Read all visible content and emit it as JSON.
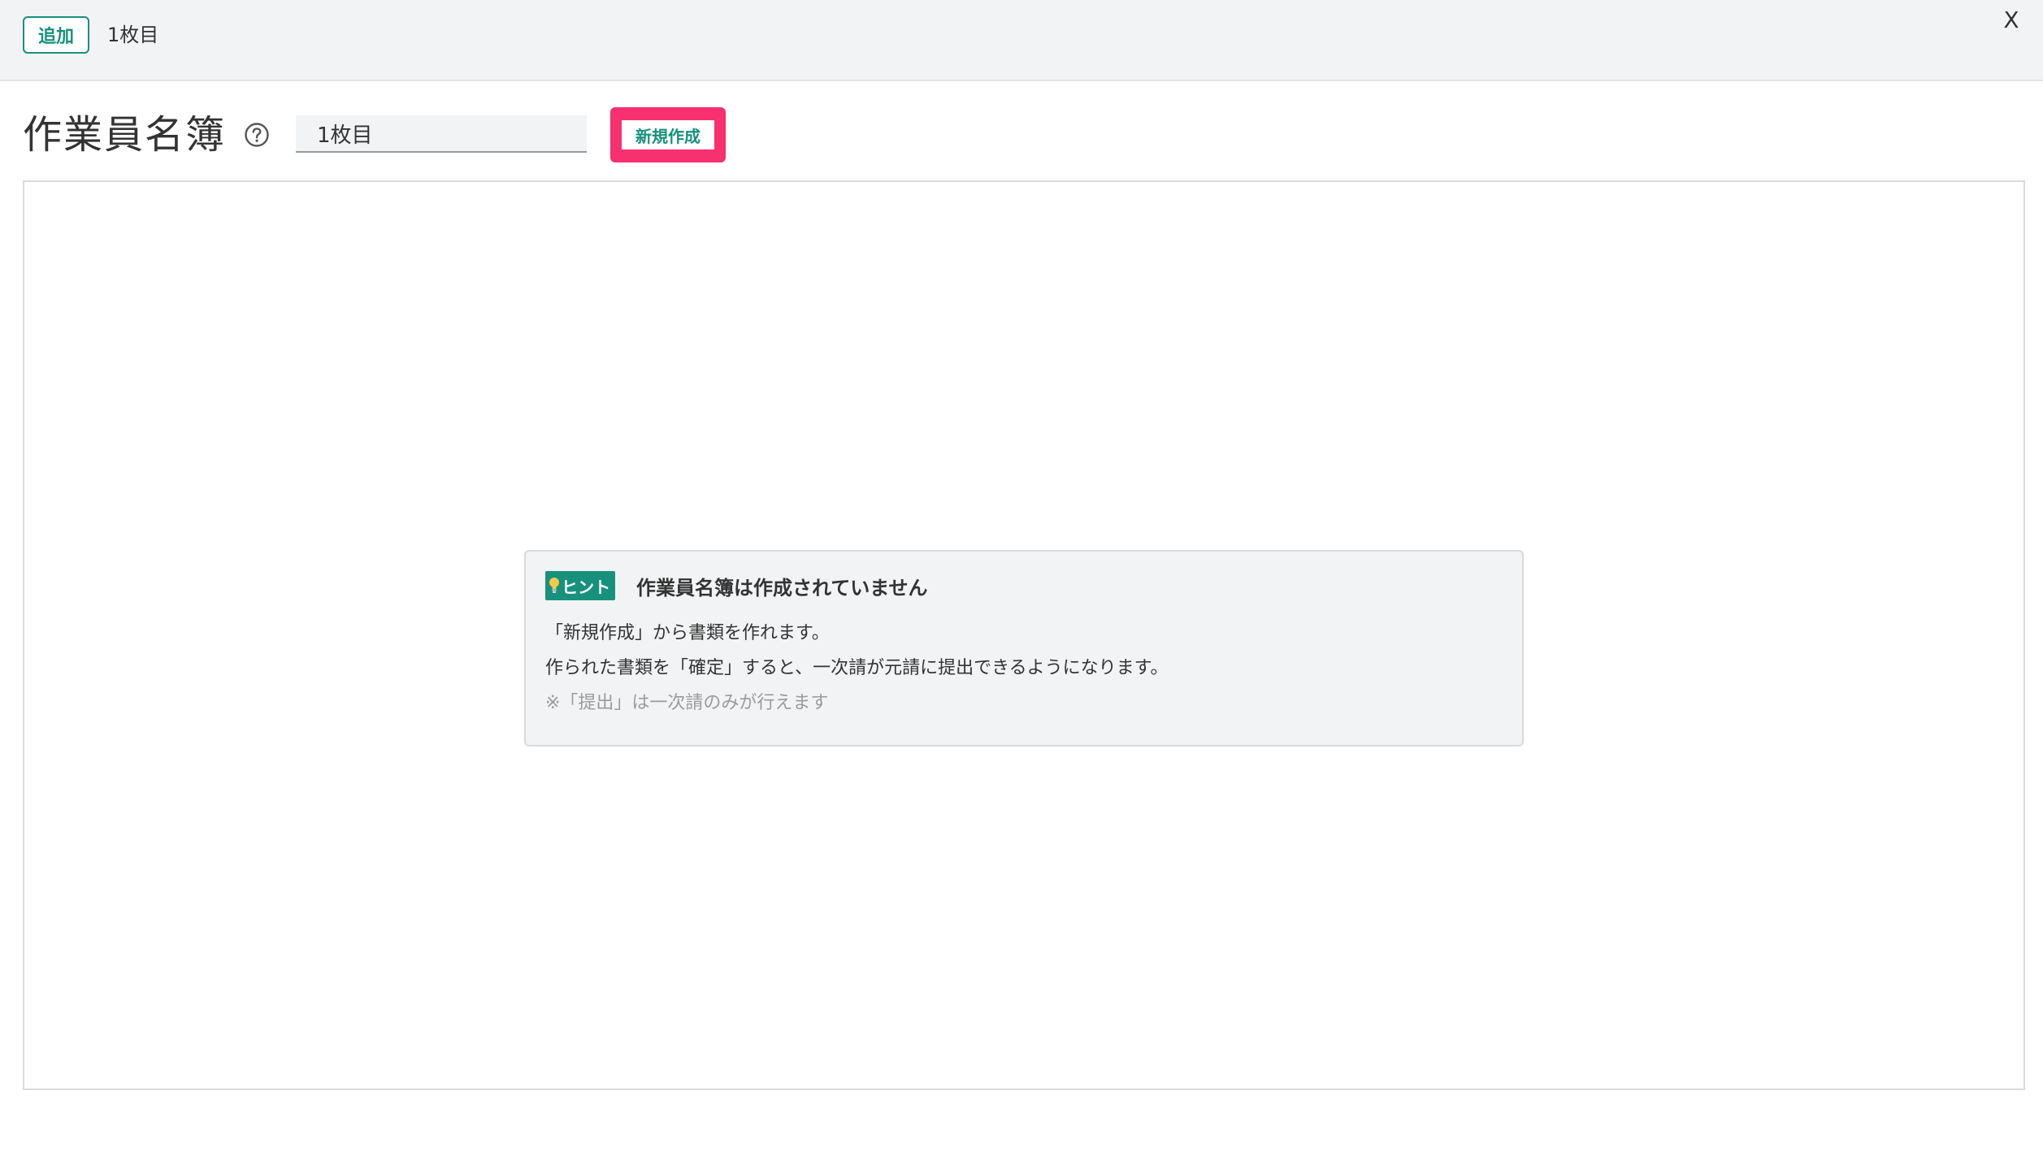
{
  "topbar": {
    "add_label": "追加",
    "tab_label": "1枚目",
    "close_label": "X"
  },
  "header": {
    "title": "作業員名簿",
    "sheet_name_value": "1枚目",
    "new_create_label": "新規作成"
  },
  "hint": {
    "badge_label": "ヒント",
    "title": "作業員名簿は作成されていません",
    "line1": "「新規作成」から書類を作れます。",
    "line2": "作られた書類を「確定」すると、一次請が元請に提出できるようになります。",
    "note": "※「提出」は一次請のみが行えます"
  },
  "colors": {
    "accent": "#17917c",
    "highlight": "#f7306f",
    "topbar_bg": "#f2f3f4"
  }
}
